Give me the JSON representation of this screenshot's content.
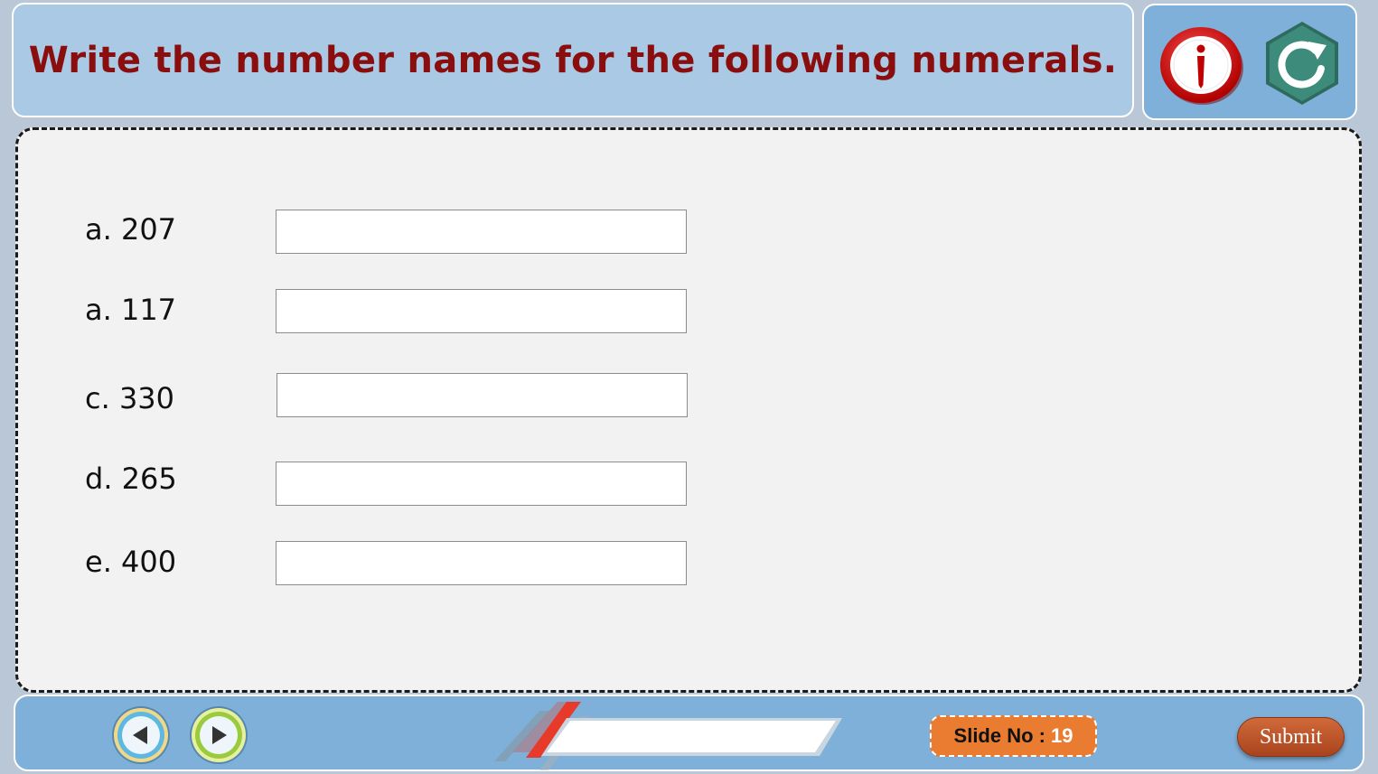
{
  "header": {
    "title": "Write the number names for the following numerals.",
    "icons": [
      "info-icon",
      "refresh-icon"
    ],
    "title_color": "#8a0e0e",
    "background_color": "#a9c9e5"
  },
  "questions": [
    {
      "label": "a. 207",
      "value": "",
      "placeholder": ""
    },
    {
      "label": "a. 117",
      "value": "",
      "placeholder": ""
    },
    {
      "label": "c. 330",
      "value": "",
      "placeholder": ""
    },
    {
      "label": "d. 265",
      "value": "",
      "placeholder": ""
    },
    {
      "label": "e. 400",
      "value": "",
      "placeholder": ""
    }
  ],
  "footer": {
    "nav_icons": [
      "previous-icon",
      "next-icon"
    ],
    "slide_label": "Slide No :",
    "slide_number": "19",
    "submit_label": "Submit",
    "slide_badge_color": "#e97c30",
    "submit_color": "#b5502a"
  }
}
